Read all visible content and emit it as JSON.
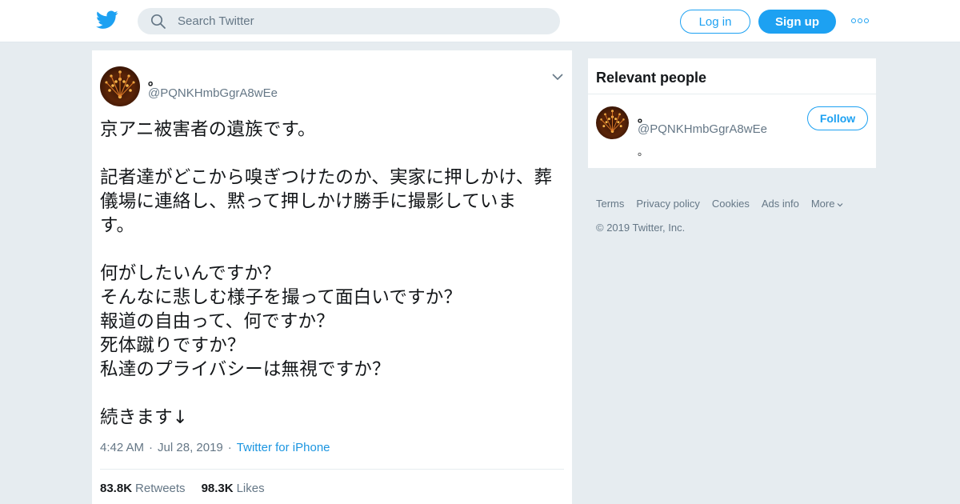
{
  "topbar": {
    "search_placeholder": "Search Twitter",
    "login_label": "Log in",
    "signup_label": "Sign up",
    "icons": {
      "logo": "twitter-bird-icon",
      "search": "search-icon",
      "more": "more-dots-icon"
    }
  },
  "tweet": {
    "display_name": "。",
    "handle": "@PQNKHmbGgrA8wEe",
    "text": "京アニ被害者の遺族です。\n\n記者達がどこから嗅ぎつけたのか、実家に押しかけ、葬儀場に連絡し、黙って押しかけ勝手に撮影していま\nす。\n\n何がしたいんですか？\nそんなに悲しむ様子を撮って面白いですか？\n報道の自由って、何ですか？\n死体蹴りですか？\n私達のプライバシーは無視ですか？\n\n続きます↓",
    "time": "4:42 AM",
    "date": "Jul 28, 2019",
    "source": "Twitter for iPhone",
    "retweets_count": "83.8K",
    "retweets_label": "Retweets",
    "likes_count": "98.3K",
    "likes_label": "Likes"
  },
  "relevant_people": {
    "title": "Relevant people",
    "person": {
      "name": "。",
      "handle": "@PQNKHmbGgrA8wEe",
      "bio": "。",
      "follow_label": "Follow"
    }
  },
  "footer": {
    "links": [
      "Terms",
      "Privacy policy",
      "Cookies",
      "Ads info",
      "More"
    ],
    "copyright": "© 2019 Twitter, Inc."
  },
  "colors": {
    "accent": "#1da1f2",
    "background": "#e6ecf0",
    "muted": "#657786"
  }
}
